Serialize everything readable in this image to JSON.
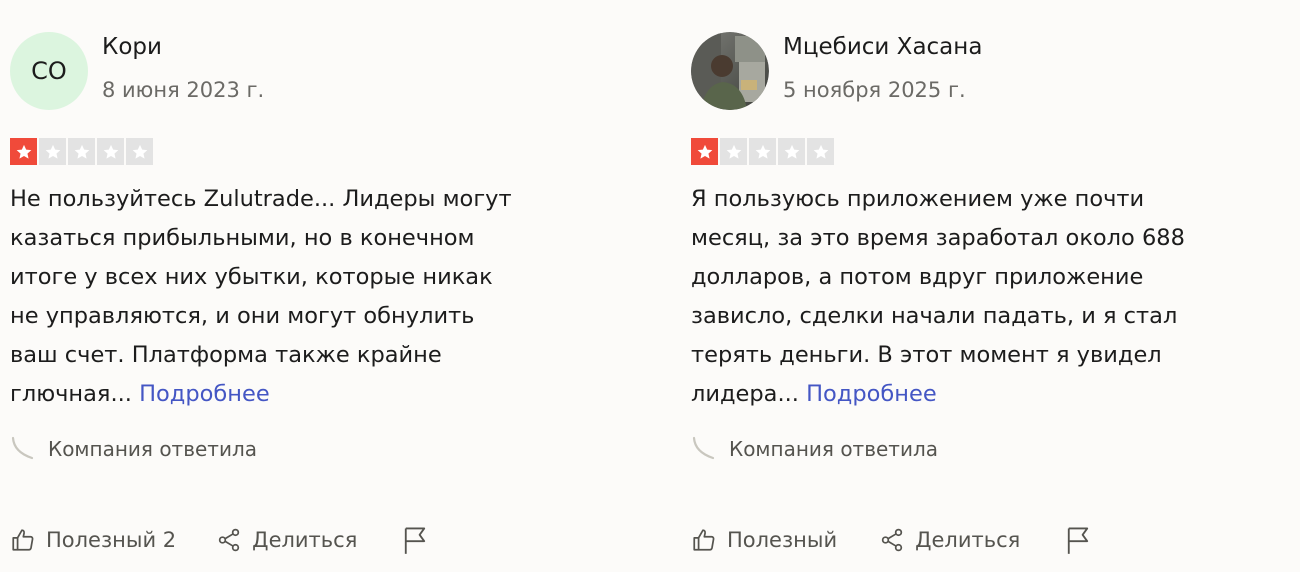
{
  "reviews": [
    {
      "author": "Кори",
      "avatar_initials": "CO",
      "avatar_type": "initials",
      "date": "8 июня 2023 г.",
      "rating": 1,
      "text_lines": [
        "Не пользуйтесь Zulutrade... Лидеры могут",
        "казаться прибыльными, но в конечном",
        "итоге у всех них убытки, которые никак",
        "не управляются, и они могут обнулить",
        "ваш счет. Платформа также крайне",
        "глючная..."
      ],
      "more_label": "Подробнее",
      "reply_label": "Компания ответила",
      "helpful_label": "Полезный 2",
      "share_label": "Делиться",
      "flag_icon": "flag-icon"
    },
    {
      "author": "Мцебиси Хасана",
      "avatar_type": "photo",
      "date": "5 ноября 2025 г.",
      "rating": 1,
      "text_lines": [
        "Я пользуюсь приложением уже почти",
        "месяц, за это время заработал около 688",
        "долларов, а потом вдруг приложение",
        "зависло, сделки начали падать, и я стал",
        "терять деньги. В этот момент я увидел",
        "лидера..."
      ],
      "more_label": "Подробнее",
      "reply_label": "Компания ответила",
      "helpful_label": "Полезный",
      "share_label": "Делиться",
      "flag_icon": "flag-icon"
    }
  ],
  "colors": {
    "star_on": "#f04a3a",
    "star_off": "#e3e3e3",
    "link": "#4456c4",
    "avatar_bg": "#dcf5df"
  }
}
